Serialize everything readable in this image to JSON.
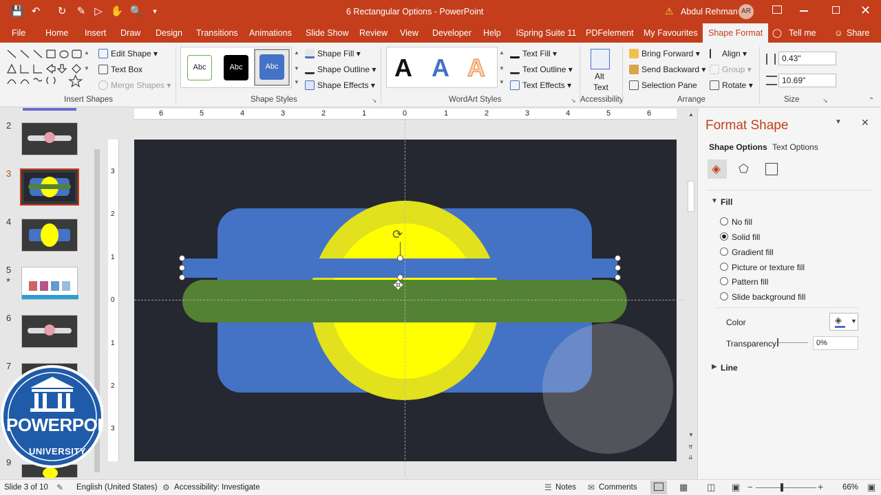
{
  "window": {
    "doc_title": "6 Rectangular Options  -  PowerPoint",
    "user_name": "Abdul Rehman",
    "user_initials": "AR"
  },
  "tabs": [
    "File",
    "Home",
    "Insert",
    "Draw",
    "Design",
    "Transitions",
    "Animations",
    "Slide Show",
    "Review",
    "View",
    "Developer",
    "Help",
    "iSpring Suite 11",
    "PDFelement",
    "My Favourites",
    "Shape Format"
  ],
  "tell_me": "Tell me",
  "share": "Share",
  "ribbon": {
    "edit_shape": "Edit Shape",
    "text_box": "Text Box",
    "merge_shapes": "Merge Shapes",
    "insert_shapes_label": "Insert Shapes",
    "style_sample": "Abc",
    "shape_fill": "Shape Fill",
    "shape_outline": "Shape Outline",
    "shape_effects": "Shape Effects",
    "shape_styles_label": "Shape Styles",
    "wordart_letter": "A",
    "text_fill": "Text Fill",
    "text_outline": "Text Outline",
    "text_effects": "Text Effects",
    "wordart_label": "WordArt Styles",
    "alt_text_1": "Alt",
    "alt_text_2": "Text",
    "accessibility_label": "Accessibility",
    "bring_forward": "Bring Forward",
    "send_backward": "Send Backward",
    "selection_pane": "Selection Pane",
    "align": "Align",
    "group": "Group",
    "rotate": "Rotate",
    "arrange_label": "Arrange",
    "height": "0.43\"",
    "width": "10.69\"",
    "size_label": "Size"
  },
  "ruler": [
    "6",
    "5",
    "4",
    "3",
    "2",
    "1",
    "0",
    "1",
    "2",
    "3",
    "4",
    "5",
    "6"
  ],
  "vruler": [
    "3",
    "2",
    "1",
    "0",
    "1",
    "2",
    "3"
  ],
  "thumbnails": [
    "2",
    "3",
    "4",
    "5",
    "6",
    "7",
    "9"
  ],
  "logo": {
    "text": "POWERPOINT",
    "subtext": "UNIVERSITY"
  },
  "pane": {
    "title": "Format Shape",
    "tab_shape": "Shape Options",
    "tab_text": "Text Options",
    "fill_header": "Fill",
    "options": [
      "No fill",
      "Solid fill",
      "Gradient fill",
      "Picture or texture fill",
      "Pattern fill",
      "Slide background fill"
    ],
    "selected": 1,
    "color_label": "Color",
    "transparency_label": "Transparency",
    "transparency_value": "0%",
    "line_header": "Line"
  },
  "status": {
    "slide": "Slide 3 of 10",
    "language": "English (United States)",
    "accessibility": "Accessibility: Investigate",
    "notes": "Notes",
    "comments": "Comments",
    "zoom": "66%"
  },
  "colors": {
    "accent": "#c43e1c",
    "slide_bg": "#252830",
    "blue": "#4472c4",
    "yellow": "#ffff00",
    "green": "#548235"
  }
}
